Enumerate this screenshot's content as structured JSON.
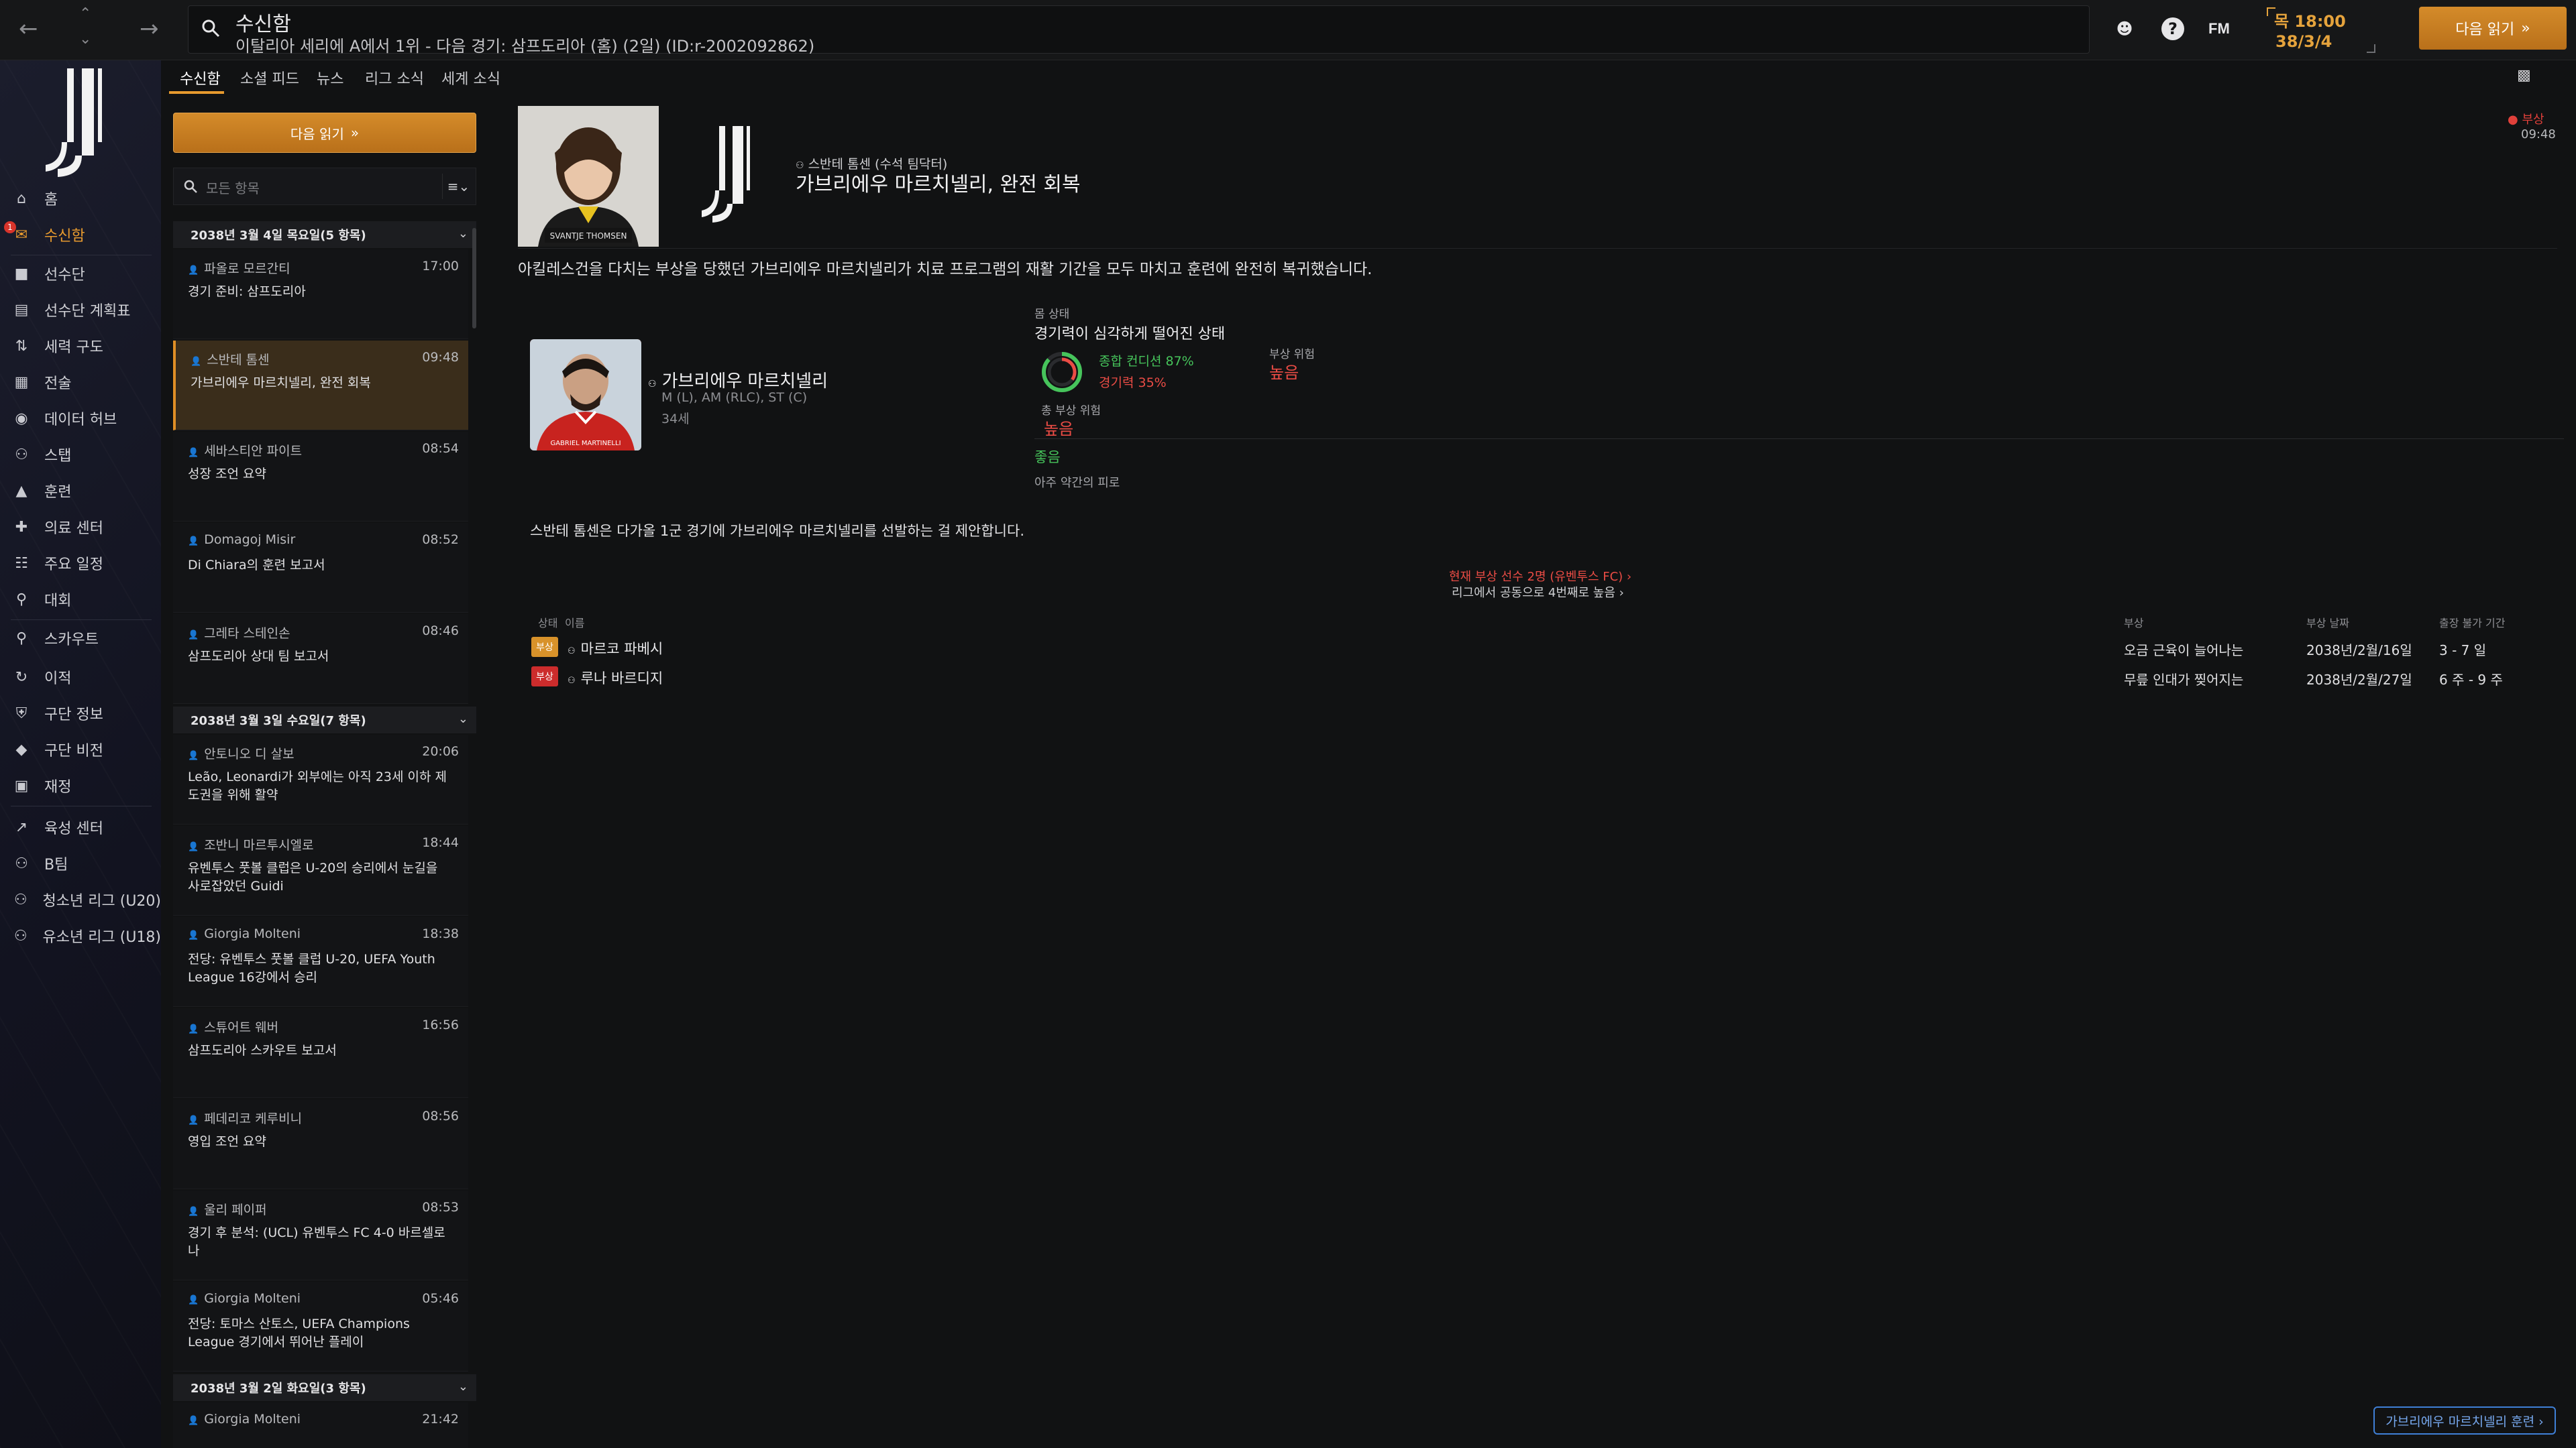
{
  "topbar": {
    "title": "수신함",
    "subtitle": "이탈리아 세리에 A에서 1위 - 다음 경기: 삼프도리아 (홈) (2일) (ID:r-2002092862)",
    "fm_logo": "FM",
    "time": "목 18:00",
    "date": "38/3/4",
    "continue_label": "다음 읽기"
  },
  "sidebar": {
    "items": [
      {
        "label": "홈",
        "icon": "home-icon"
      },
      {
        "label": "수신함",
        "icon": "inbox-icon",
        "badge": "1"
      },
      {
        "label": "선수단",
        "icon": "shirt-icon"
      },
      {
        "label": "선수단 계획표",
        "icon": "clipboard-icon"
      },
      {
        "label": "세력 구도",
        "icon": "dynamics-icon"
      },
      {
        "label": "전술",
        "icon": "tactics-icon"
      },
      {
        "label": "데이터 허브",
        "icon": "data-hub-icon"
      },
      {
        "label": "스탭",
        "icon": "staff-icon"
      },
      {
        "label": "훈련",
        "icon": "training-icon"
      },
      {
        "label": "의료 센터",
        "icon": "medical-icon"
      },
      {
        "label": "주요 일정",
        "icon": "calendar-icon"
      },
      {
        "label": "대회",
        "icon": "trophy-icon"
      },
      {
        "label": "스카우트",
        "icon": "scouting-icon"
      },
      {
        "label": "이적",
        "icon": "transfer-icon"
      },
      {
        "label": "구단 정보",
        "icon": "club-info-icon"
      },
      {
        "label": "구단 비전",
        "icon": "club-vision-icon"
      },
      {
        "label": "재정",
        "icon": "finance-icon"
      },
      {
        "label": "육성 센터",
        "icon": "development-icon"
      },
      {
        "label": "B팀",
        "icon": "b-team-icon"
      },
      {
        "label": "청소년 리그 (U20)",
        "icon": "u20-icon"
      },
      {
        "label": "유소년 리그 (U18)",
        "icon": "u18-icon"
      }
    ]
  },
  "tabs": [
    "수신함",
    "소셜 피드",
    "뉴스",
    "리그 소식",
    "세계 소식"
  ],
  "inbox": {
    "continue_label": "다음 읽기",
    "filter_placeholder": "모든 항목",
    "days": [
      {
        "label": "2038년 3월 4일 목요일(5 항목)"
      },
      {
        "label": "2038년 3월 3일 수요일(7 항목)"
      },
      {
        "label": "2038년 3월 2일 화요일(3 항목)"
      }
    ],
    "messages": [
      {
        "sender": "파올로 모르간티",
        "time": "17:00",
        "subject": "경기 준비: 삼프도리아"
      },
      {
        "sender": "스반테 톰센",
        "time": "09:48",
        "subject": "가브리에우 마르치넬리, 완전 회복"
      },
      {
        "sender": "세바스티안 파이트",
        "time": "08:54",
        "subject": "성장 조언 요약"
      },
      {
        "sender": "Domagoj Misir",
        "time": "08:52",
        "subject": "Di Chiara의 훈련 보고서"
      },
      {
        "sender": "그레타 스테인손",
        "time": "08:46",
        "subject": "삼프도리아 상대 팀 보고서"
      },
      {
        "sender": "안토니오 디 살보",
        "time": "20:06",
        "subject": "Leão, Leonardi가 외부에는 아직 23세 이하 제도권을 위해 활약"
      },
      {
        "sender": "조반니 마르투시엘로",
        "time": "18:44",
        "subject": "유벤투스 풋볼 클럽은 U-20의 승리에서 눈길을 사로잡았던 Guidi"
      },
      {
        "sender": "Giorgia Molteni",
        "time": "18:38",
        "subject": "전당: 유벤투스 풋볼 클럽 U-20, UEFA Youth League 16강에서 승리"
      },
      {
        "sender": "스튜어트 웨버",
        "time": "16:56",
        "subject": "삼프도리아 스카우트 보고서"
      },
      {
        "sender": "페데리코 케루비니",
        "time": "08:56",
        "subject": "영입 조언 요약"
      },
      {
        "sender": "울리 페이퍼",
        "time": "08:53",
        "subject": "경기 후 분석: (UCL) 유벤투스 FC 4-0 바르셀로나"
      },
      {
        "sender": "Giorgia Molteni",
        "time": "05:46",
        "subject": "전당: 토마스 산토스, UEFA Champions League 경기에서 뛰어난 플레이"
      },
      {
        "sender": "Giorgia Molteni",
        "time": "21:42",
        "subject": ""
      }
    ]
  },
  "detail": {
    "sender_line": "스반테 톰센 (수석 팀닥터)",
    "title": "가브리에우 마르치넬리, 완전 회복",
    "tag": "부상",
    "time": "09:48",
    "photo_caption": "SVANTJE THOMSEN",
    "body": "아킬레스건을 다치는 부상을 당했던 가브리에우 마르치넬리가 치료 프로그램의 재활 기간을 모두 마치고 훈련에 완전히 복귀했습니다.",
    "player": {
      "name": "가브리에우 마르치넬리",
      "position": "M (L), AM (RLC), ST (C)",
      "age": "34세",
      "shirt_name": "GABRIEL MARTINELLI"
    },
    "condition": {
      "label": "몸 상태",
      "status": "경기력이 심각하게 떨어진 상태",
      "overall": "종합 컨디션 87%",
      "overall_value": 87,
      "sharpness": "경기력 35%",
      "sharpness_value": 35,
      "injury_risk_label": "부상 위험",
      "injury_risk_value": "높음",
      "total_risk_label": "총 부상 위험",
      "total_risk_value": "높음",
      "fatigue": "좋음",
      "fatigue_note": "아주 약간의 피로"
    },
    "suggestion": "스반테 톰센은 다가올 1군 경기에 가브리에우 마르치넬리를 선발하는 걸 제안합니다.",
    "injury_link": "현재 부상 선수 2명 (유벤투스 FC) ›",
    "league_link": "리그에서 공동으로 4번째로 높음 ›",
    "table_headers": {
      "status": "상태",
      "name": "이름",
      "injury": "부상",
      "date": "부상 날짜",
      "duration": "출장 불가 기간"
    },
    "rows": [
      {
        "tag": "부상",
        "tag_color": "#d8922a",
        "name": "마르코 파베시",
        "injury": "오금 근육이 늘어나는",
        "date": "2038년/2월/16일",
        "duration": "3 - 7 일"
      },
      {
        "tag": "부상",
        "tag_color": "#cc2c2c",
        "name": "루나 바르디지",
        "injury": "무릎 인대가 찢어지는",
        "date": "2038년/2월/27일",
        "duration": "6 주 - 9 주"
      }
    ],
    "bottom_link": "가브리에우 마르치넬리 훈련 ›"
  }
}
